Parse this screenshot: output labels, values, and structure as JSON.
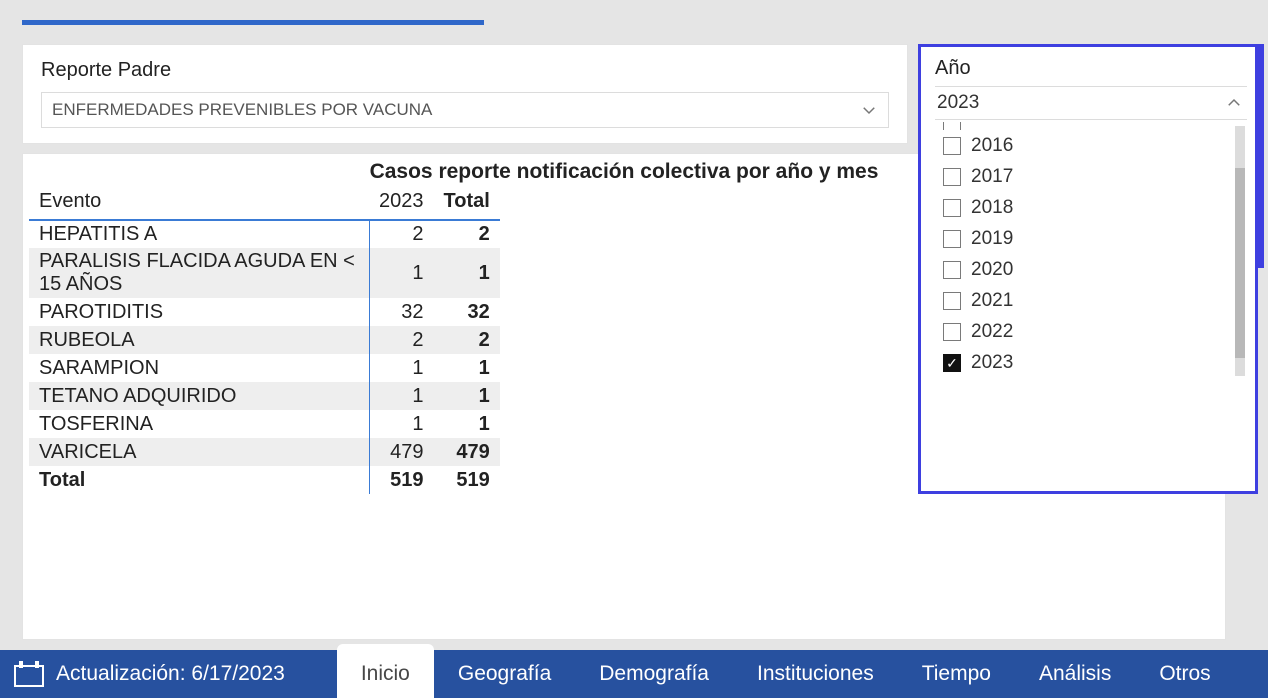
{
  "reporte_padre": {
    "label": "Reporte Padre",
    "selected": "ENFERMEDADES PREVENIBLES POR VACUNA"
  },
  "table": {
    "title": "Casos reporte notificación colectiva por año y mes",
    "headers": {
      "evento": "Evento",
      "year": "2023",
      "total": "Total"
    },
    "rows": [
      {
        "evento": "HEPATITIS A",
        "y2023": "2",
        "total": "2"
      },
      {
        "evento": "PARALISIS FLACIDA AGUDA EN < 15 AÑOS",
        "y2023": "1",
        "total": "1"
      },
      {
        "evento": "PAROTIDITIS",
        "y2023": "32",
        "total": "32"
      },
      {
        "evento": "RUBEOLA",
        "y2023": "2",
        "total": "2"
      },
      {
        "evento": "SARAMPION",
        "y2023": "1",
        "total": "1"
      },
      {
        "evento": "TETANO ADQUIRIDO",
        "y2023": "1",
        "total": "1"
      },
      {
        "evento": "TOSFERINA",
        "y2023": "1",
        "total": "1"
      },
      {
        "evento": "VARICELA",
        "y2023": "479",
        "total": "479"
      }
    ],
    "totals": {
      "label": "Total",
      "y2023": "519",
      "total": "519"
    }
  },
  "year_slicer": {
    "label": "Año",
    "selected": "2023",
    "options": [
      {
        "label": "2016",
        "checked": false
      },
      {
        "label": "2017",
        "checked": false
      },
      {
        "label": "2018",
        "checked": false
      },
      {
        "label": "2019",
        "checked": false
      },
      {
        "label": "2020",
        "checked": false
      },
      {
        "label": "2021",
        "checked": false
      },
      {
        "label": "2022",
        "checked": false
      },
      {
        "label": "2023",
        "checked": true
      }
    ]
  },
  "footer": {
    "update_label": "Actualización: 6/17/2023",
    "tabs": [
      {
        "label": "Inicio",
        "active": true
      },
      {
        "label": "Geografía",
        "active": false
      },
      {
        "label": "Demografía",
        "active": false
      },
      {
        "label": "Instituciones",
        "active": false
      },
      {
        "label": "Tiempo",
        "active": false
      },
      {
        "label": "Análisis",
        "active": false
      },
      {
        "label": "Otros",
        "active": false
      }
    ]
  }
}
